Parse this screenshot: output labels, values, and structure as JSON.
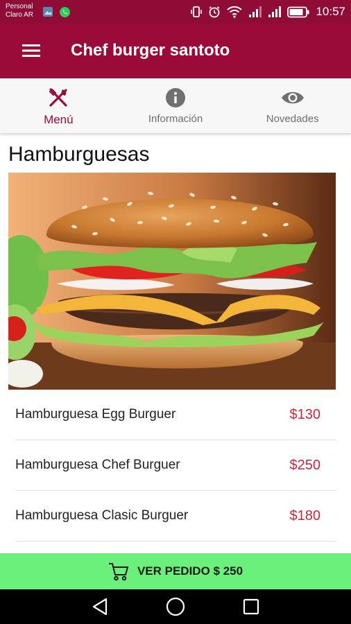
{
  "status_bar": {
    "carrier_line1": "Personal",
    "carrier_line2": "Claro AR",
    "time": "10:57"
  },
  "app_bar": {
    "title": "Chef burger santoto"
  },
  "tabs": [
    {
      "label": "Menú",
      "icon": "fork-knife-icon",
      "active": true
    },
    {
      "label": "Información",
      "icon": "info-icon",
      "active": false
    },
    {
      "label": "Novedades",
      "icon": "eye-icon",
      "active": false
    }
  ],
  "section": {
    "title": "Hamburguesas"
  },
  "menu_items": [
    {
      "name": "Hamburguesa Egg Burguer",
      "price": "$130"
    },
    {
      "name": "Hamburguesa Chef Burguer",
      "price": "$250"
    },
    {
      "name": "Hamburguesa Clasic Burguer",
      "price": "$180"
    }
  ],
  "order_bar": {
    "label": "VER PEDIDO $ 250"
  },
  "colors": {
    "primary": "#9b0b3a",
    "status_bar": "#8e0c36",
    "price": "#c7283b",
    "order_bar": "#6cf07c"
  }
}
